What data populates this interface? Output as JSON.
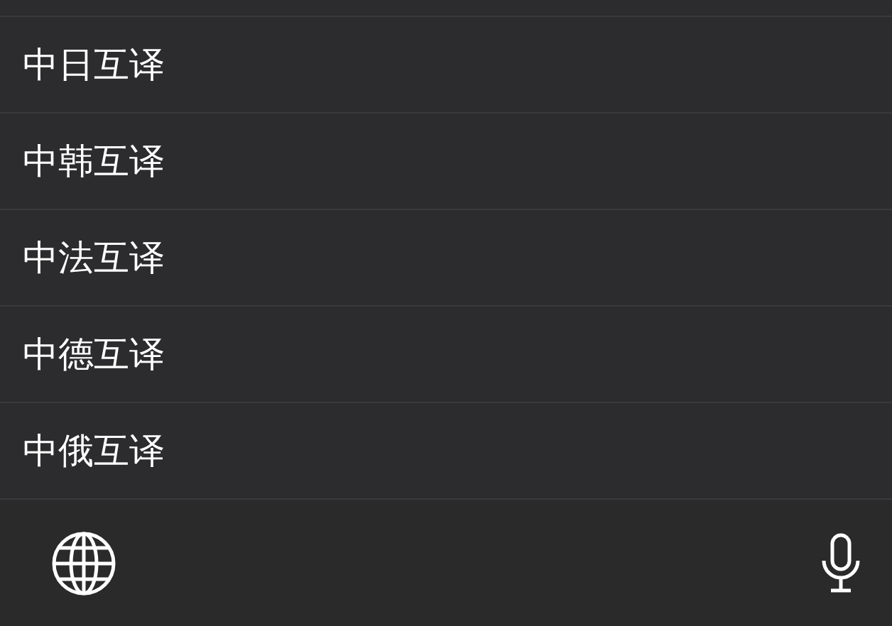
{
  "languages": [
    {
      "label": "中日互译"
    },
    {
      "label": "中韩互译"
    },
    {
      "label": "中法互译"
    },
    {
      "label": "中德互译"
    },
    {
      "label": "中俄互译"
    }
  ]
}
